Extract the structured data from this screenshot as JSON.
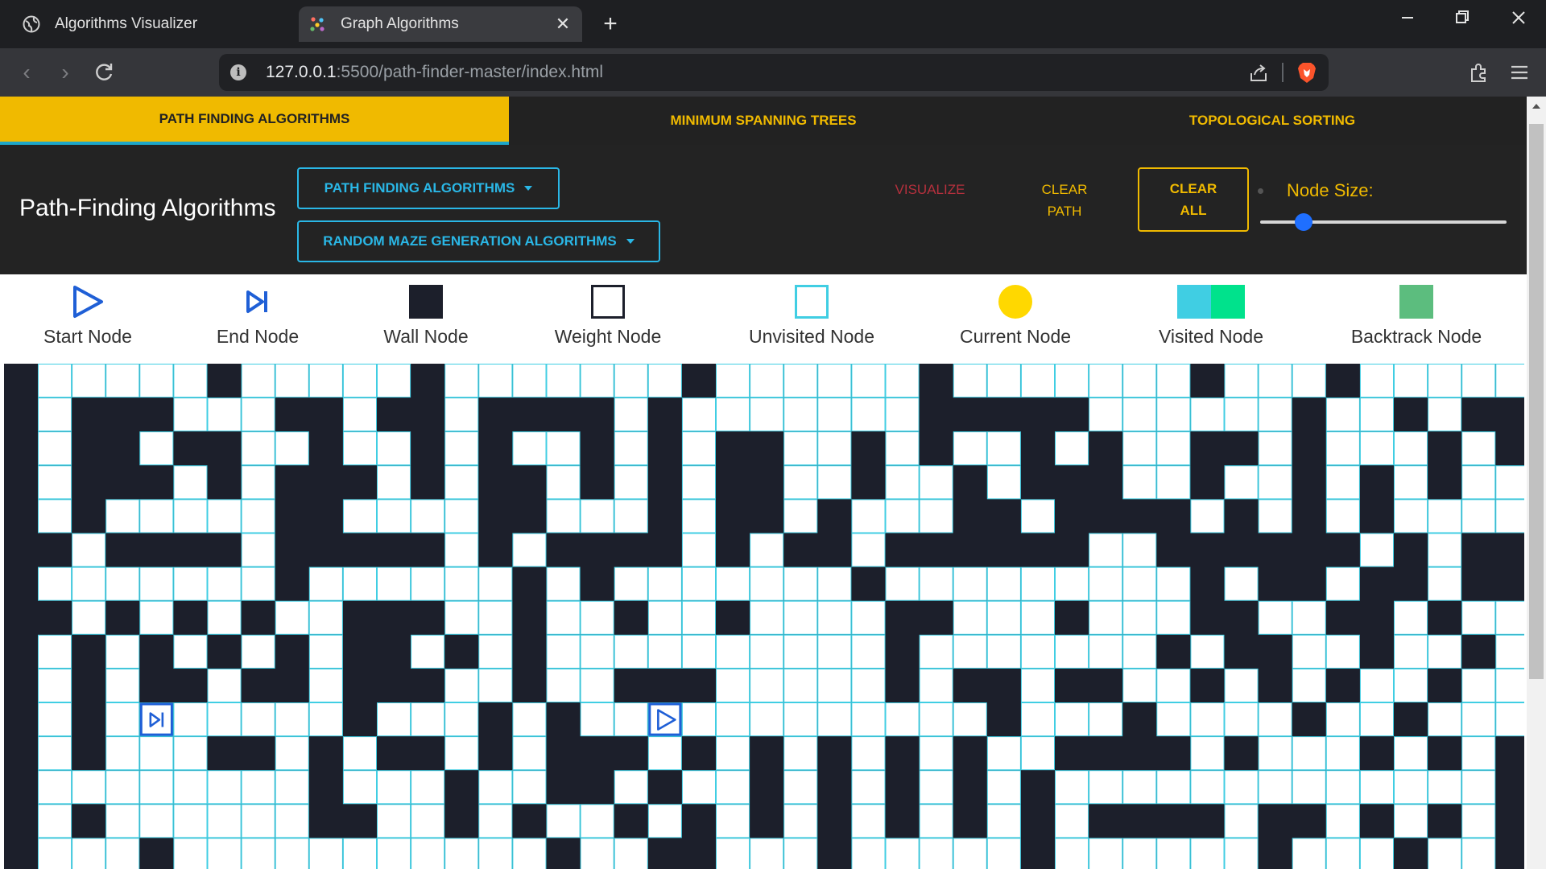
{
  "browser": {
    "tabs": [
      {
        "title": "Algorithms Visualizer",
        "active": false
      },
      {
        "title": "Graph Algorithms",
        "active": true
      }
    ],
    "url_host": "127.0.0.1",
    "url_rest": ":5500/path-finder-master/index.html"
  },
  "topnav": {
    "items": [
      {
        "label": "PATH FINDING ALGORITHMS",
        "active": true
      },
      {
        "label": "MINIMUM SPANNING TREES",
        "active": false
      },
      {
        "label": "TOPOLOGICAL SORTING",
        "active": false
      }
    ]
  },
  "header": {
    "title": "Path-Finding Algorithms",
    "dropdown_algorithms": "PATH FINDING ALGORITHMS",
    "dropdown_maze": "RANDOM MAZE GENERATION ALGORITHMS",
    "visualize": "VISUALIZE",
    "clear_path_line1": "CLEAR",
    "clear_path_line2": "PATH",
    "clear_all_line1": "CLEAR",
    "clear_all_line2": "ALL",
    "node_size_label": "Node Size:",
    "node_size_value": 0.15
  },
  "legend": {
    "items": [
      {
        "label": "Start Node",
        "icon": "start-icon"
      },
      {
        "label": "End Node",
        "icon": "end-icon"
      },
      {
        "label": "Wall Node",
        "icon": "wall-icon"
      },
      {
        "label": "Weight Node",
        "icon": "weight-icon"
      },
      {
        "label": "Unvisited Node",
        "icon": "unvisited-icon"
      },
      {
        "label": "Current Node",
        "icon": "current-icon"
      },
      {
        "label": "Visited Node",
        "icon": "visited-icon"
      },
      {
        "label": "Backtrack Node",
        "icon": "backtrack-icon"
      }
    ]
  },
  "colors": {
    "accent_yellow": "#f0ba00",
    "accent_cyan": "#2ab7e6",
    "wall": "#1c1f2b",
    "visualize_red": "#b5303d",
    "visited_a": "#40cee3",
    "visited_b": "#00e28c",
    "backtrack": "#5cbd7e",
    "current": "#ffd800",
    "node_blue": "#1f5fd6"
  },
  "maze": {
    "rows": [
      "#.....#.....#.......#......#.......#...#......#.......#.#",
      "#.###...##.##.####.#.......#####......#..#.####.....#..##",
      "#.##.##..#..#.#..#.#.##..#.#..#.#..##.#...#.#..###.##.###",
      "#.###.#.###.#.##.#.#.##..#..#.###..#..#.#.#..##.#...#.###",
      "#.#.....##....##...#.##.#...##.####.#.#.#........#.####.#",
      "##.####.#####.#.####.#.##.######..######.#.###....#.#.####",
      "#.......#......#.#.......#.........#.##.##.##..#.###......",
      "##.#.#.#..###..#..#..#....##...#...##..##.#..#..#..#.....",
      "#.#.#.#.#.##.#.#..........#.......#.##..#..#.....#.....#.",
      "#.#.##.##.###..#..###.....#.##.##..#.#.#..#..#.#.#.....#.",
      "#.#.E.....#...#.#..S.........#...#....#..#...#..#...#..#.",
      "#.#...##.#.##.#.###.#.#.#.#.#..####.#...#.#.#...#.#...#..",
      "#........#...#..##.#..#.#.#.#.#.............#.....#......",
      "#.#......##..#.#..#.#.#.#.#.#.#.####.##.#.#.#.......#..##",
      "#...#...........#..##...#.....#......#...#..#...#......#."
    ]
  }
}
